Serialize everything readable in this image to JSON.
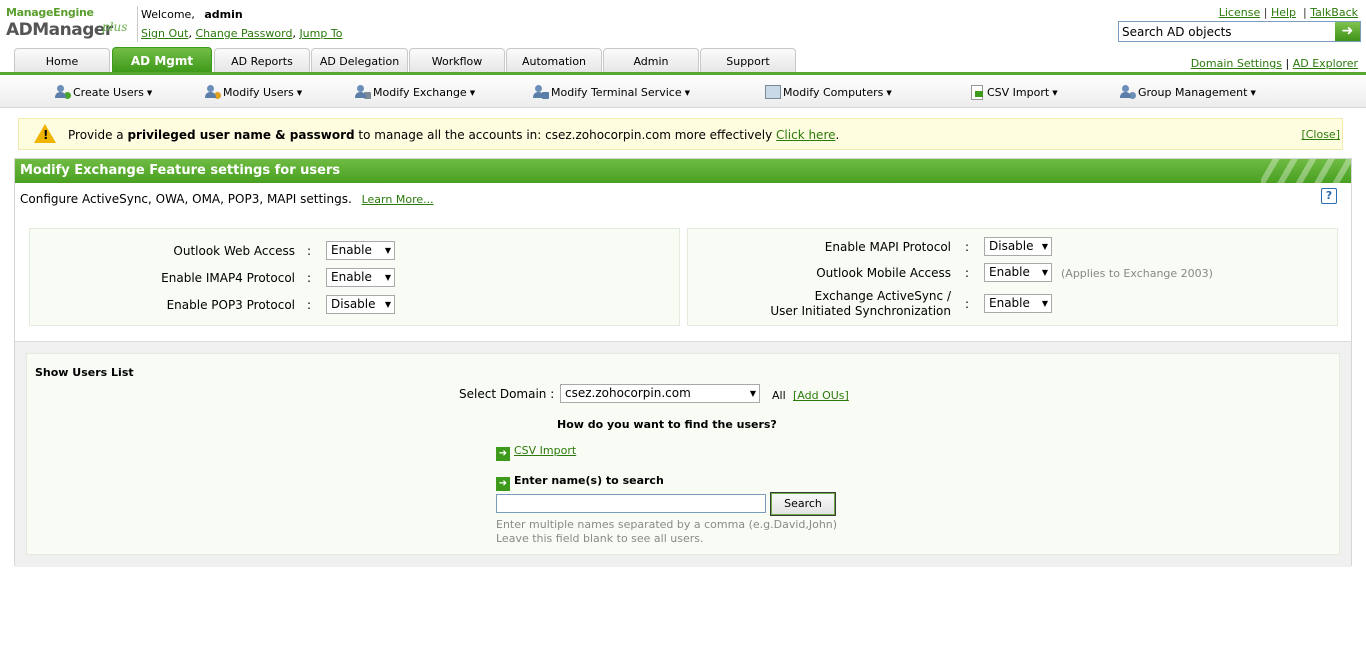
{
  "logo": {
    "brand": "ManageEngine",
    "product": "ADManager",
    "edition": "plus"
  },
  "header": {
    "welcome_label": "Welcome,",
    "username": "admin",
    "sign_out": "Sign Out",
    "change_password": "Change Password",
    "jump_to": "Jump To",
    "links": {
      "license": "License",
      "help": "Help",
      "talkback": "TalkBack"
    },
    "search_placeholder": "Search AD objects",
    "domain_settings": "Domain Settings",
    "ad_explorer": "AD Explorer"
  },
  "tabs": [
    {
      "label": "Home"
    },
    {
      "label": "AD Mgmt",
      "active": true
    },
    {
      "label": "AD Reports"
    },
    {
      "label": "AD Delegation"
    },
    {
      "label": "Workflow"
    },
    {
      "label": "Automation"
    },
    {
      "label": "Admin"
    },
    {
      "label": "Support"
    }
  ],
  "submenu": [
    {
      "label": "Create Users",
      "icon": "create-users-icon"
    },
    {
      "label": "Modify Users",
      "icon": "modify-users-icon"
    },
    {
      "label": "Modify Exchange",
      "icon": "modify-exchange-icon"
    },
    {
      "label": "Modify Terminal Service",
      "icon": "terminal-service-icon"
    },
    {
      "label": "Modify Computers",
      "icon": "computer-icon"
    },
    {
      "label": "CSV Import",
      "icon": "csv-import-icon"
    },
    {
      "label": "Group Management",
      "icon": "group-icon"
    }
  ],
  "alert": {
    "prefix": "Provide a ",
    "bold": "privileged user name & password",
    "middle": " to manage all the accounts in: csez.zohocorpin.com more effectively ",
    "link": "Click here",
    "suffix": ".",
    "close": "[Close]"
  },
  "panel": {
    "title": "Modify Exchange Feature settings for users",
    "description": "Configure ActiveSync, OWA, OMA, POP3, MAPI settings.",
    "learn_more": "Learn More...",
    "help": "?",
    "colon": ":",
    "left_settings": [
      {
        "label": "Outlook Web Access",
        "value": "Enable"
      },
      {
        "label": "Enable IMAP4 Protocol",
        "value": "Enable"
      },
      {
        "label": "Enable POP3 Protocol",
        "value": "Disable"
      }
    ],
    "right_settings": [
      {
        "label": "Enable MAPI Protocol",
        "value": "Disable"
      },
      {
        "label": "Outlook Mobile Access",
        "value": "Enable",
        "note": "(Applies to Exchange 2003)"
      },
      {
        "label_line1": "Exchange ActiveSync /",
        "label_line2": "User Initiated Synchronization",
        "value": "Enable"
      }
    ]
  },
  "users": {
    "title": "Show Users List",
    "select_domain_label": "Select Domain :",
    "domain": "csez.zohocorpin.com",
    "all": "All",
    "add_ous": "[Add OUs]",
    "question": "How do you want to find the users?",
    "csv_import": "CSV Import",
    "enter_names": "Enter name(s) to search",
    "search_button": "Search",
    "hint1": "Enter multiple names separated by a comma (e.g.David,John)",
    "hint2": "Leave this field blank to see all users."
  }
}
